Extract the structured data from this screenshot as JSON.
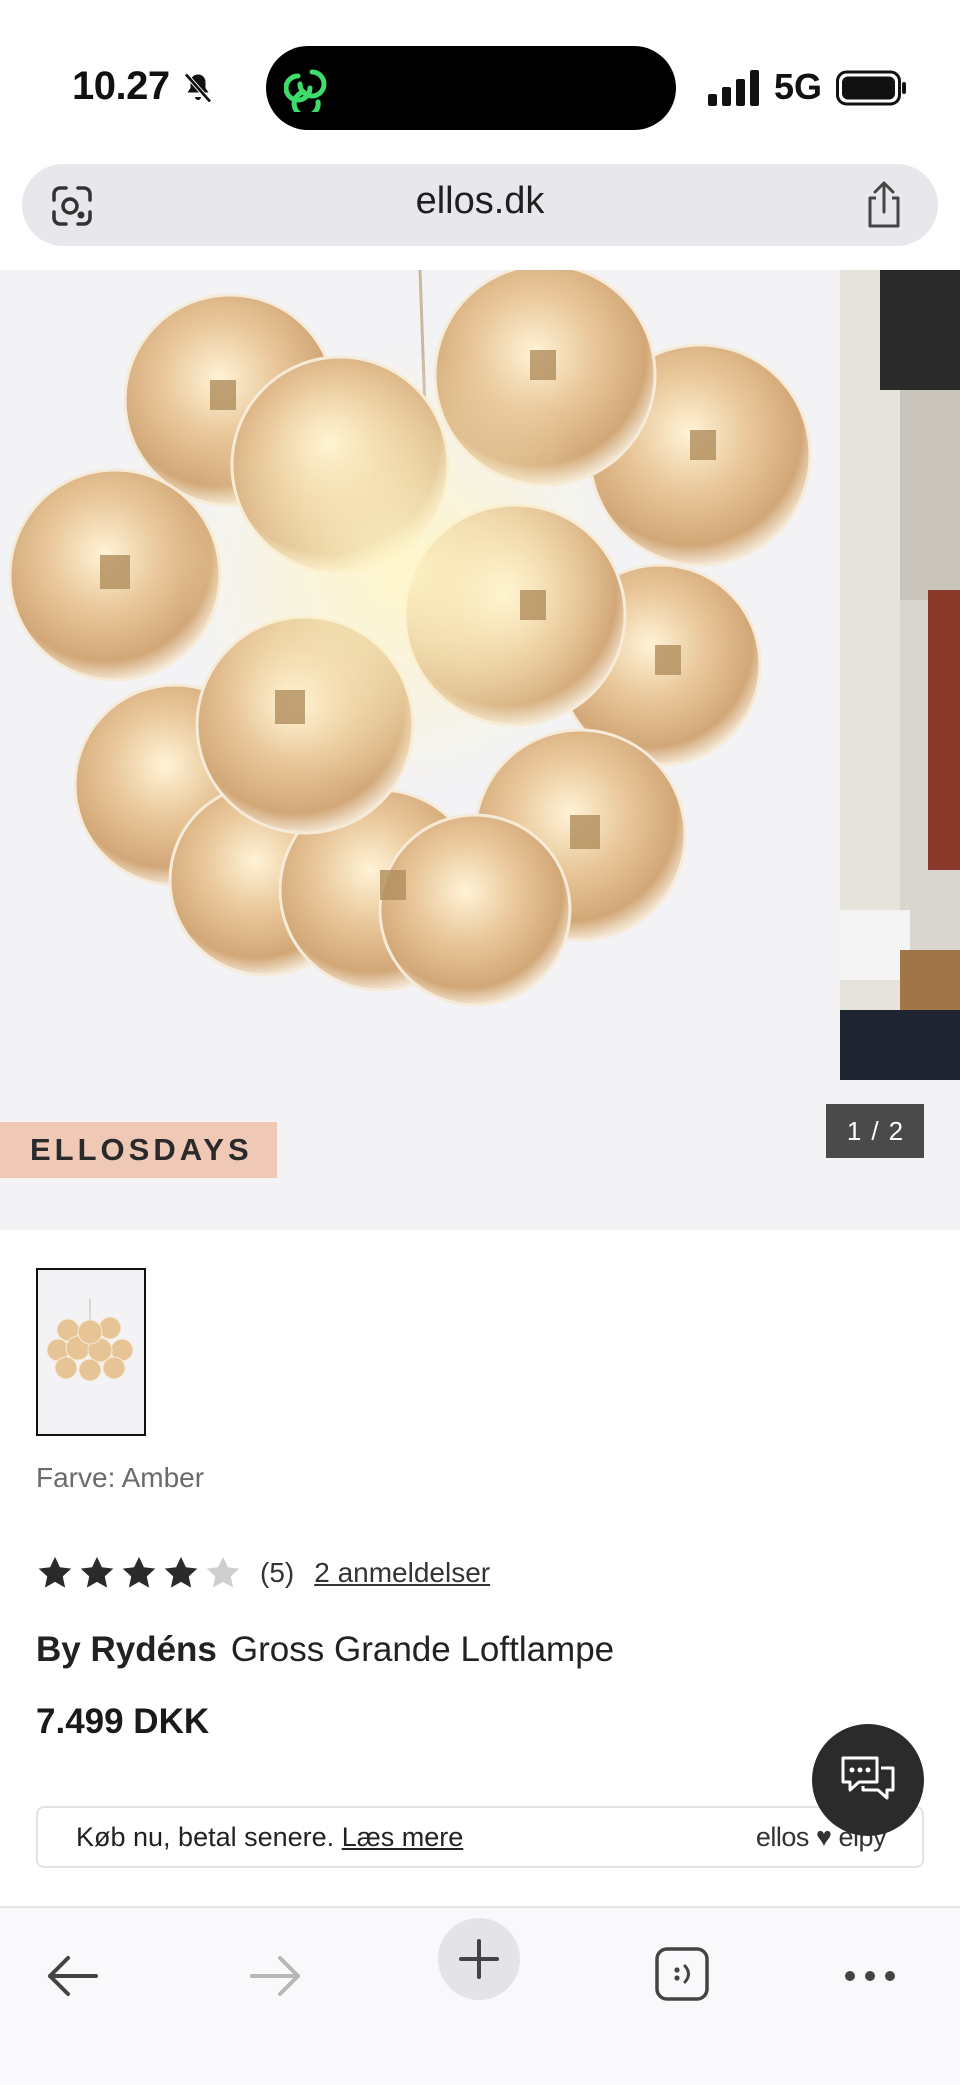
{
  "status": {
    "time": "10.27",
    "network": "5G"
  },
  "browser": {
    "url": "ellos.dk"
  },
  "gallery": {
    "badge": "ELLOSDAYS",
    "pager_current": "1",
    "pager_sep": "/",
    "pager_total": "2"
  },
  "product": {
    "color_label": "Farve: Amber",
    "rating_value": 4,
    "rating_max": 5,
    "rating_count": "(5)",
    "reviews_link": "2 anmeldelser",
    "brand": "By Rydéns",
    "name": "Gross Grande Loftlampe",
    "price": "7.499 DKK"
  },
  "paylater": {
    "text": "Køb nu, betal senere.",
    "link": "Læs mere",
    "logo": "ellos ♥ elpy"
  },
  "icons": {
    "bell": "bell-slash-icon",
    "lens": "google-lens-icon",
    "share": "share-icon",
    "chat": "chat-bubbles-icon",
    "back": "back-arrow-icon",
    "forward": "forward-arrow-icon",
    "new_tab": "plus-icon",
    "tabs": "tabs-icon",
    "more": "more-dots-icon"
  },
  "colors": {
    "badge_bg": "#efc9b5",
    "pager_bg": "#4a4a4a",
    "star_filled": "#2a2a2a",
    "star_empty": "#cfcfcf",
    "island_icon": "#3ddc6b"
  }
}
